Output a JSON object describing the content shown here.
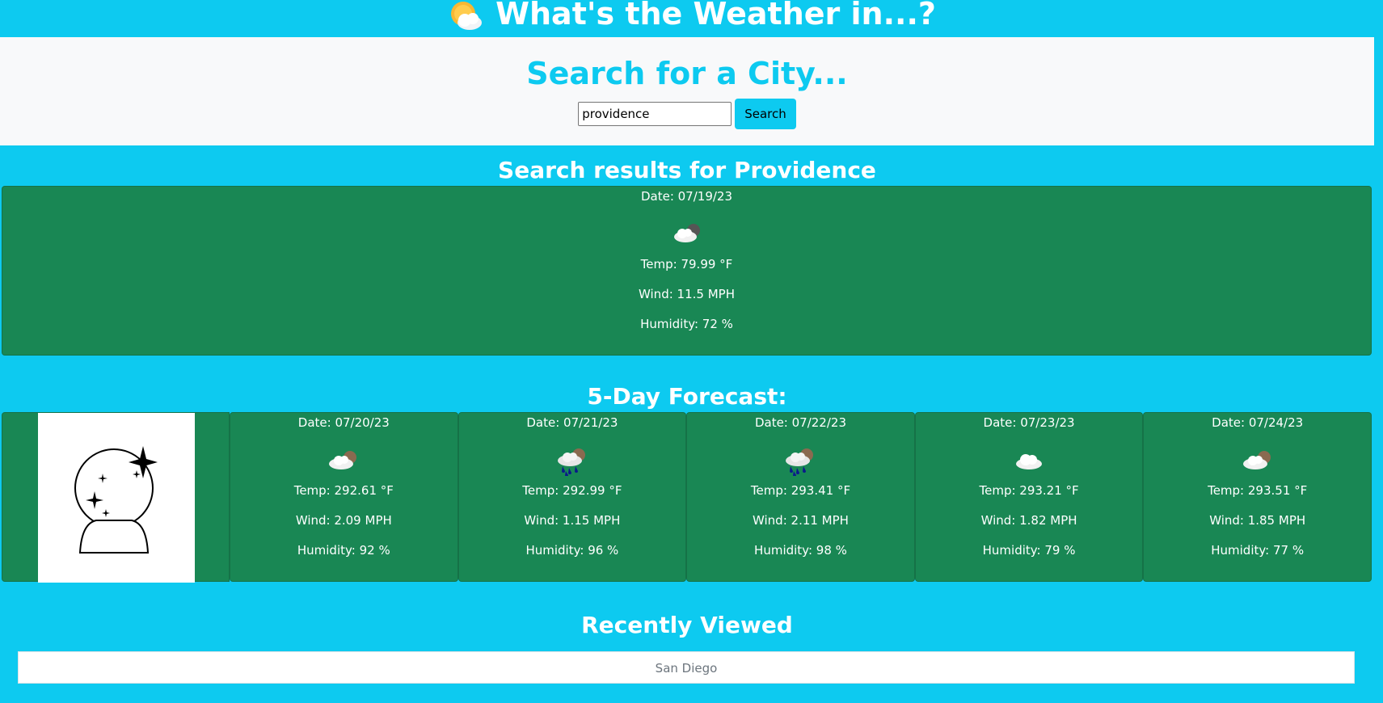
{
  "header": {
    "title": "What's the Weather in...?",
    "icon": "sun-behind-cloud-icon"
  },
  "search": {
    "title": "Search for a City...",
    "input_value": "providence",
    "button_label": "Search"
  },
  "results": {
    "title": "Search results for Providence",
    "current": {
      "date": "Date: 07/19/23",
      "icon": "cloud-moon-icon",
      "temp": "Temp: 79.99 °F",
      "wind": "Wind: 11.5 MPH",
      "humidity": "Humidity: 72 %"
    }
  },
  "forecast": {
    "title": "5-Day Forecast:",
    "placeholder_icon": "crystal-ball-icon",
    "days": [
      {
        "date": "Date: 07/20/23",
        "icon": "cloud-partial-icon",
        "temp": "Temp: 292.61 °F",
        "wind": "Wind: 2.09 MPH",
        "humidity": "Humidity: 92 %"
      },
      {
        "date": "Date: 07/21/23",
        "icon": "rain-cloud-icon",
        "temp": "Temp: 292.99 °F",
        "wind": "Wind: 1.15 MPH",
        "humidity": "Humidity: 96 %"
      },
      {
        "date": "Date: 07/22/23",
        "icon": "rain-cloud-icon",
        "temp": "Temp: 293.41 °F",
        "wind": "Wind: 2.11 MPH",
        "humidity": "Humidity: 98 %"
      },
      {
        "date": "Date: 07/23/23",
        "icon": "cloud-icon",
        "temp": "Temp: 293.21 °F",
        "wind": "Wind: 1.82 MPH",
        "humidity": "Humidity: 79 %"
      },
      {
        "date": "Date: 07/24/23",
        "icon": "cloud-partial-icon",
        "temp": "Temp: 293.51 °F",
        "wind": "Wind: 1.85 MPH",
        "humidity": "Humidity: 77 %"
      }
    ]
  },
  "recent": {
    "title": "Recently Viewed",
    "items": [
      "San Diego"
    ]
  },
  "colors": {
    "background": "#0dcaf0",
    "card": "#198754",
    "panel": "#f8f9fa"
  }
}
